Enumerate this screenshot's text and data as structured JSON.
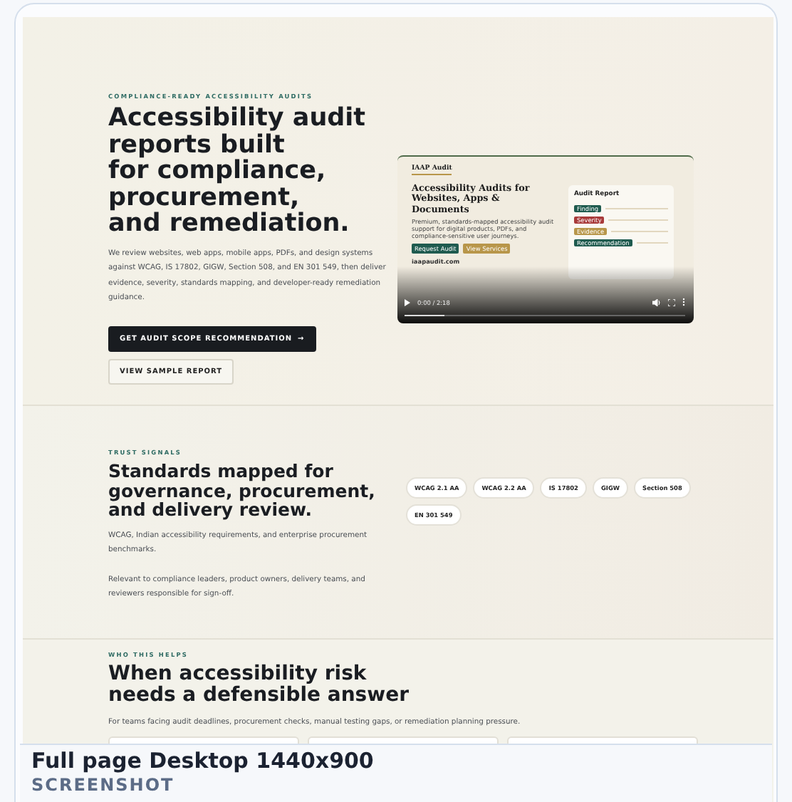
{
  "hero": {
    "eyebrow": "COMPLIANCE-READY ACCESSIBILITY AUDITS",
    "title_lines": [
      "Accessibility audit",
      "reports built",
      "for compliance,",
      "procurement,",
      "and remediation."
    ],
    "body": "We review websites, web apps, mobile apps, PDFs, and design systems against WCAG, IS 17802, GIGW, Section 508, and EN 301 549, then deliver evidence, severity, standards mapping, and developer-ready remediation guidance.",
    "primary_button": "GET AUDIT SCOPE RECOMMENDATION",
    "primary_icon": "→",
    "secondary_button": "VIEW SAMPLE REPORT"
  },
  "video": {
    "brand": "IAAP Audit",
    "headline": "Accessibility Audits for Websites, Apps & Documents",
    "blurb": "Premium, standards-mapped accessibility audit support for digital products, PDFs, and compliance-sensitive user journeys.",
    "buttons": [
      {
        "label": "Request Audit",
        "color": "#1f5b4f"
      },
      {
        "label": "View Services",
        "color": "#b8964a"
      }
    ],
    "domain": "iaapaudit.com",
    "report_title": "Audit Report",
    "report_tags": [
      {
        "label": "Finding",
        "color": "#1f5b4f"
      },
      {
        "label": "Severity",
        "color": "#a83a3a"
      },
      {
        "label": "Evidence",
        "color": "#b8964a"
      },
      {
        "label": "Recommendation",
        "color": "#1f5b4f"
      }
    ],
    "time": "0:00 / 2:18",
    "level": 0.14
  },
  "trust": {
    "eyebrow": "TRUST SIGNALS",
    "title": "Standards mapped for governance, procurement, and delivery review.",
    "paragraphs": [
      "WCAG, Indian accessibility requirements, and enterprise procurement benchmarks.",
      "Relevant to compliance leaders, product owners, delivery teams, and reviewers responsible for sign-off."
    ],
    "standards": [
      "WCAG 2.1 AA",
      "WCAG 2.2 AA",
      "IS 17802",
      "GIGW",
      "Section 508",
      "EN 301 549"
    ]
  },
  "who": {
    "eyebrow": "WHO THIS HELPS",
    "title_lines": [
      "When accessibility risk",
      "needs a defensible answer"
    ],
    "body": "For teams facing audit deadlines, procurement checks, manual testing gaps, or remediation planning pressure."
  },
  "caption": {
    "title": "Full page Desktop 1440x900",
    "tag": "SCREENSHOT"
  }
}
